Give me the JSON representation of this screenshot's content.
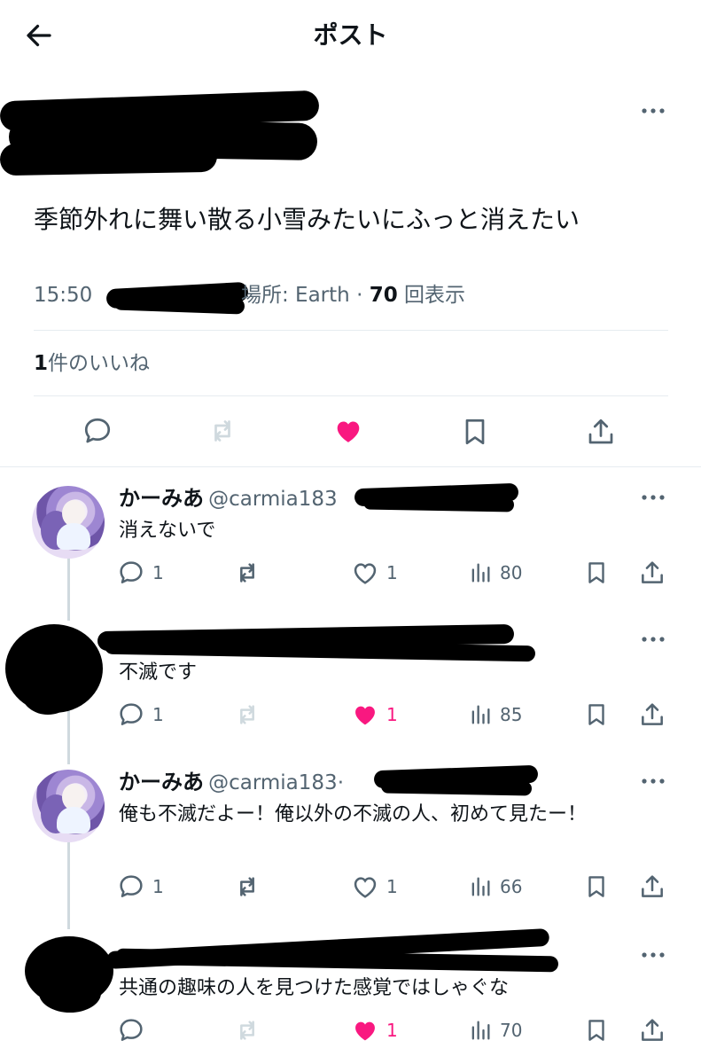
{
  "header": {
    "title": "ポスト"
  },
  "post": {
    "text": "季節外れに舞い散る小雪みたいにふっと消えたい",
    "meta": {
      "time": "15:50",
      "location_label": "場所: Earth",
      "views_count": "70",
      "views_label": "回表示"
    },
    "likes": {
      "count": "1",
      "label": "件のいいね"
    }
  },
  "replies": [
    {
      "name": "かーみあ",
      "handle": "@carmia183",
      "text": "消えないで",
      "reply_count": "1",
      "like_count": "1",
      "view_count": "80",
      "liked": false
    },
    {
      "name": "",
      "handle": "",
      "text": "不滅です",
      "reply_count": "1",
      "like_count": "1",
      "view_count": "85",
      "liked": true
    },
    {
      "name": "かーみあ",
      "handle": "@carmia183",
      "separator": "·",
      "text": "俺も不滅だよー！俺以外の不滅の人、初めて見たー！",
      "reply_count": "1",
      "like_count": "1",
      "view_count": "66",
      "liked": false
    },
    {
      "name": "",
      "handle": "",
      "text": "共通の趣味の人を見つけた感覚ではしゃぐな",
      "reply_count": "",
      "like_count": "1",
      "view_count": "70",
      "liked": true
    }
  ],
  "icons": {
    "back": "arrow-left-icon",
    "more": "more-horizontal-icon",
    "reply": "reply-icon",
    "repost": "repost-icon",
    "like": "heart-icon",
    "bookmark": "bookmark-icon",
    "share": "share-icon",
    "views": "views-icon"
  },
  "colors": {
    "accent_like": "#f91880",
    "muted": "#536471",
    "divider": "#e6ecf0",
    "text": "#0f1419"
  }
}
